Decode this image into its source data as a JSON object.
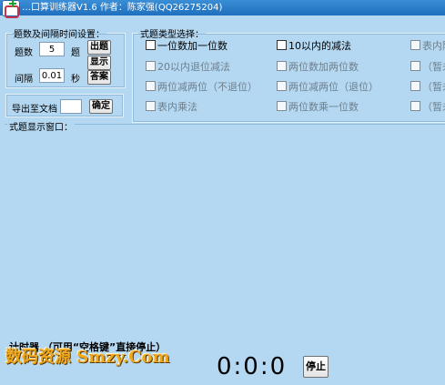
{
  "window": {
    "title": "…口算训练器V1.6  作者：陈家强(QQ26275204)"
  },
  "settings": {
    "legend": "题数及间隔时间设置：",
    "count_label": "题数",
    "count_value": "5",
    "count_unit": "题",
    "interval_label": "间隔",
    "interval_value": "0.01",
    "interval_unit": "秒",
    "btn_generate": "出题",
    "btn_show": "显示",
    "btn_answer": "答案"
  },
  "export": {
    "legend": "导出至文档",
    "btn_confirm": "确定"
  },
  "types": {
    "legend": "式题类型选择：",
    "options": [
      {
        "label": "一位数加一位数"
      },
      {
        "label": "10以内的减法"
      },
      {
        "label": "表内除法"
      },
      {
        "label": "20以内退位减法"
      },
      {
        "label": "两位数加两位数"
      },
      {
        "label": "（暂未"
      },
      {
        "label": "两位减两位（不退位）"
      },
      {
        "label": "两位减两位（退位）"
      },
      {
        "label": "（暂未"
      },
      {
        "label": "表内乘法"
      },
      {
        "label": "两位数乘一位数"
      },
      {
        "label": "（暂未"
      }
    ]
  },
  "display": {
    "label": "式题显示窗口："
  },
  "timer": {
    "label": "计时器  （可用“空格键”直接停止）",
    "value": "0:0:0",
    "btn_stop": "停止"
  },
  "watermark": "数码资源 Smzy.Com"
}
